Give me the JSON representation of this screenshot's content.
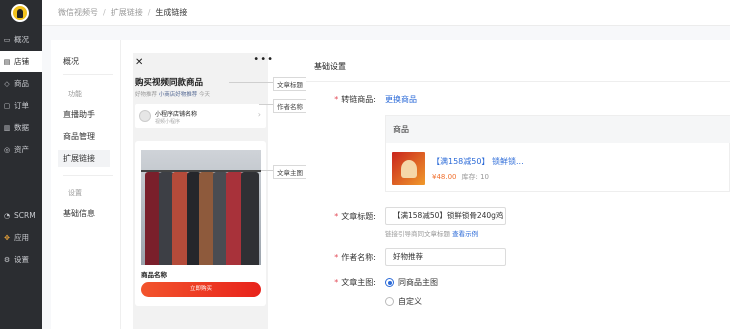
{
  "left_nav": {
    "items": [
      {
        "label": "概况",
        "icon": "monitor-icon"
      },
      {
        "label": "店铺",
        "icon": "store-icon",
        "active": true
      },
      {
        "label": "商品",
        "icon": "tag-icon"
      },
      {
        "label": "订单",
        "icon": "order-icon"
      },
      {
        "label": "数据",
        "icon": "chart-icon"
      },
      {
        "label": "资产",
        "icon": "asset-icon"
      },
      {
        "label": "SCRM",
        "icon": "user-icon"
      },
      {
        "label": "应用",
        "icon": "apps-icon"
      },
      {
        "label": "设置",
        "icon": "gear-icon"
      }
    ]
  },
  "breadcrumb": {
    "items": [
      "微信视频号",
      "扩展链接",
      "生成链接"
    ],
    "separator": "/"
  },
  "sub_nav": {
    "overview": "概况",
    "group_function": "功能",
    "live_assistant": "直播助手",
    "product_mgmt": "商品管理",
    "extend_link": "扩展链接",
    "group_settings": "设置",
    "basic_info": "基础信息"
  },
  "preview": {
    "close": "✕",
    "more": "•••",
    "article_title": "购买视频同款商品",
    "meta_prefix": "好物推荐",
    "meta_author": "小商店好物推荐",
    "meta_suffix": "今天",
    "mini_name": "小程序店铺名称",
    "mini_sub": "视频小程序",
    "product_name": "商品名称",
    "buy_button": "立即购买",
    "callouts": {
      "title": "文章标题",
      "author": "作者名称",
      "cover": "文章主图"
    }
  },
  "settings": {
    "section_title": "基础设置",
    "link_product_label": "转链商品:",
    "change_product": "更换商品",
    "table_header": "商品",
    "product_title": "【满158减50】 锁鲜锁...",
    "product_price": "¥48.00",
    "product_stock": "库存: 10",
    "article_title_label": "文章标题:",
    "article_title_value": "【满158减50】锁鲜锁骨240g鸡",
    "hint_text": "链接引导商同文章标题",
    "hint_link": "查看示例",
    "author_label": "作者名称:",
    "author_value": "好物推荐",
    "cover_label": "文章主图:",
    "option_same": "同商品主图",
    "option_custom": "自定义",
    "required_mark": "*"
  },
  "colors": {
    "accent": "#2c6bd8",
    "nav_bg": "#2b2d31",
    "price": "#f0702e",
    "buy": "#e8231b"
  }
}
